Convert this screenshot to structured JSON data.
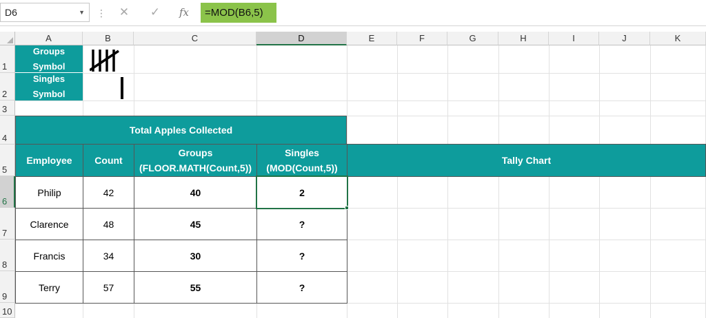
{
  "name_box": "D6",
  "formula": "=MOD(B6,5)",
  "columns": [
    "A",
    "B",
    "C",
    "D",
    "E",
    "F",
    "G",
    "H",
    "I",
    "J",
    "K"
  ],
  "rows": [
    "1",
    "2",
    "3",
    "4",
    "5",
    "6",
    "7",
    "8",
    "9",
    "10"
  ],
  "symbols": {
    "groups_label": "Groups\nSymbol",
    "singles_label": "Singles\nSymbol"
  },
  "table": {
    "title": "Total Apples Collected",
    "headers": {
      "employee": "Employee",
      "count": "Count",
      "groups": "Groups\n(FLOOR.MATH(Count,5))",
      "singles": "Singles\n(MOD(Count,5))",
      "tally": "Tally Chart"
    },
    "rows": [
      {
        "employee": "Philip",
        "count": "42",
        "groups": "40",
        "singles": "2"
      },
      {
        "employee": "Clarence",
        "count": "48",
        "groups": "45",
        "singles": "?"
      },
      {
        "employee": "Francis",
        "count": "34",
        "groups": "30",
        "singles": "?"
      },
      {
        "employee": "Terry",
        "count": "57",
        "groups": "55",
        "singles": "?"
      }
    ]
  },
  "colors": {
    "header_teal": "#0e9c9c",
    "formula_highlight": "#8bc34a",
    "excel_green": "#217346"
  },
  "icons": [
    "name-box-dropdown-icon",
    "cancel-icon",
    "enter-icon",
    "insert-function-icon"
  ]
}
